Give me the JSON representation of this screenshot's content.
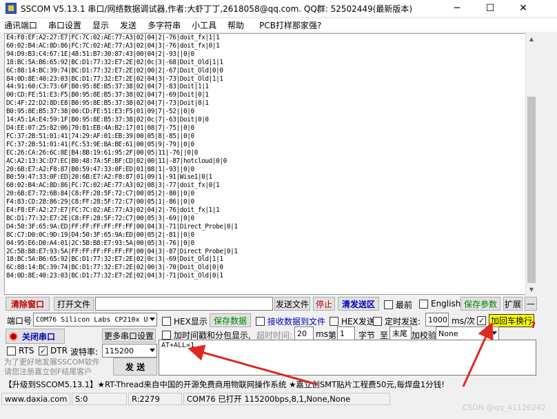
{
  "window": {
    "title": "SSCOM V5.13.1 串口/网络数据调试器,作者:大虾丁丁,2618058@qq.com. QQ群: 52502449(最新版本)",
    "minimize": "─",
    "maximize": "☐",
    "close": "✕"
  },
  "menu": [
    "通讯端口",
    "串口设置",
    "显示",
    "发送",
    "多字符串",
    "小工具",
    "帮助",
    "PCB打样那家强?"
  ],
  "terminal_lines": [
    "E4:F8:EF:A2:27:E7|FC:7C:02:AE:77:A3|02|04|2|-76|doit_fx|1|1",
    "60:02:B4:AC:8D:86|FC:7C:02:AE:77:A3|02|04|3|-76|doit_fx|0|1",
    "94:D9:B3:C4:67:1E|48:51:B7:30:87:43|00|04|2|-93||0|0",
    "18:BC:5A:B6:65:92|BC:D1:77:32:E7:2E|02|0c|3|-68|Doit_Old|1|1",
    "6C:88:14:BC:39:74|BC:D1:77:32:E7:2E|02|00|2|-67|Doit_Old|0|0",
    "84:0D:8E:40:23:03|BC:D1:77:32:E7:2E|02|04|3|-73|Doit_Old|1|1",
    "44:91:60:C3:73:6F|B0:95:8E:B5:37:38|02|04|7|-83|Doit|1|1",
    "00:CD:FE:51:E3:F5|B0:95:8E:B5:37:38|02|04|7|-69|Doit|0|1",
    "DC:4F:22:D2:8D:E8|B0:95:8E:B5:37:38|02|04|7|-73|Doit|0|1",
    "B0:95:8E:B5:37:38|00:CD:FE:51:E3:F5|01|09|7|-52||0|0",
    "14:A5:1A:E4:59:1F|B0:95:8E:B5:37:38|02|0c|7|-63|Doit|0|0",
    "D4:EE:07:25:82:06|70:81:EB:4A:B2:17|01|08|7|-75||0|0",
    "FC:37:2B:51:01:41|74:29:AF:01:EB:39|00|05|8|-85||0|0",
    "FC:37:2B:51:01:41|FC:53:9E:BA:BE:61|00|05|9|-79||0|0",
    "EC:26:CA:26:6C:8E|B4:8B:19:61:95:2F|00|05|11|-76||0|0",
    "AC:A2:13:3C:D7:EC|B0:48:7A:5F:BF:CD|02|00|11|-87|hotcloud|0|0",
    "20:6B:E7:A2:F8:87|B0:59:47:33:0F:ED|01|08|1|-93||0|0",
    "B0:59:47:33:0F:ED|20:6B:E7:A2:F8:87|01|09|1|-91|Wise1|0|1",
    "60:02:B4:AC:8D:86|FC:7C:02:AE:77:A3|02|08|3|-77|doit_fx|0|1",
    "20:6B:E7:72:6B:84|C8:FF:28:5F:72:C7|00|05|2|-80||0|0",
    "F4:83:CD:28:86:29|C8:FF:28:5F:72:C7|00|05|1|-86||0|0",
    "E4:F8:EF:A2:27:E7|FC:7C:02:AE:77:A3|02|04|2|-76|doit_fx|1|1",
    "BC:D1:77:32:E7:2E|C8:FF:28:5F:72:C7|00|05|3|-69||0|0",
    "D4:50:3F:65:9A:ED|FF:FF:FF:FF:FF:FF|00|04|3|-71|Direct_Probe|0|1",
    "8C:C7:D0:0C:9D:19|D4:50:3F:65:9A:ED|00|05|2|-81||0|0",
    "04:95:E6:D0:A4:01|2C:5B:B8:E7:93:5A|00|05|3|-76||0|0",
    "2C:5B:B8:E7:93:5A|FF:FF:FF:FF:FF:FF|00|04|3|-87|Direct_Probe|0|1",
    "18:BC:5A:B6:65:92|BC:D1:77:32:E7:2E|02|0c|3|-69|Doit_Old|1|1",
    "6C:88:14:BC:39:74|BC:D1:77:32:E7:2E|02|00|3|-70|Doit_Old|0|0",
    "84:0D:8E:40:23:03|BC:D1:77:32:E7:2E|02|04|3|-71|Doit_Old|0|1"
  ],
  "toolbar": {
    "clear_window": "清除窗口",
    "open_file": "打开文件",
    "send_file": "发送文件",
    "stop": "停止",
    "clear_send": "清发送区",
    "topmost": "最前",
    "english": "English",
    "save_params": "保存参数",
    "expand": "扩展",
    "collapse": "—"
  },
  "port": {
    "label": "端口号",
    "value": "COM76 Silicon Labs CP210x U",
    "close_button": "关闭串口",
    "more_settings": "更多串口设置",
    "rts": "RTS",
    "dtr": "DTR",
    "baud_label": "波特率:",
    "baud_value": "115200"
  },
  "options": {
    "hex_display": "HEX显示",
    "save_data": "保存数据",
    "recv_to_file": "接收数据到文件",
    "hex_send": "HEX发送",
    "timed_send": "定时发送:",
    "interval_value": "1000",
    "interval_unit": "ms/次",
    "add_crlf": "加回车换行",
    "timestamp": "加时间戳和分包显示,",
    "timeout_label": "超时时间:",
    "timeout_value": "20",
    "ms": "ms",
    "nth_label": "第",
    "nth_value": "1",
    "byte_label": "字节",
    "to_label": "至",
    "end_value": "末尾",
    "checksum_label": "加校验",
    "checksum_value": "None",
    "question": "?"
  },
  "send": {
    "text": "AT+ALL=1",
    "button": "发 送"
  },
  "promo": "为了更好地发展SSCOM软件\n请您注册嘉立创F结尾客户",
  "ticker": "【升级到SSCOM5.13.1】★RT-Thread来自中国的开源免费商用物联网操作系统      ★嘉立创SMT贴片工程费50元,每焊盘1分钱!",
  "status": {
    "website": "www.daxia.com",
    "sent": "S:0",
    "received": "R:2279",
    "port_status": "COM76 已打开  115200bps,8,1,None,None"
  },
  "watermark": "CSDN @qq_41126242",
  "colors": {
    "arrow": "#e0281e",
    "highlight": "#ffff00"
  }
}
